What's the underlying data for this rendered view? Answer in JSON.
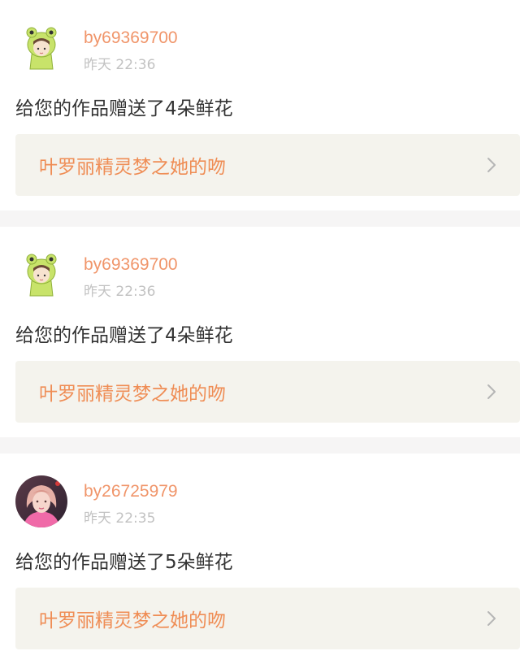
{
  "posts": [
    {
      "username": "by69369700",
      "time": "昨天 22:36",
      "message": "给您的作品赠送了4朵鲜花",
      "work_title": "叶罗丽精灵梦之她的吻",
      "avatar": "frog-hood-avatar-icon"
    },
    {
      "username": "by69369700",
      "time": "昨天 22:36",
      "message": "给您的作品赠送了4朵鲜花",
      "work_title": "叶罗丽精灵梦之她的吻",
      "avatar": "frog-hood-avatar-icon"
    },
    {
      "username": "by26725979",
      "time": "昨天 22:35",
      "message": "给您的作品赠送了5朵鲜花",
      "work_title": "叶罗丽精灵梦之她的吻",
      "avatar": "girl-photo-avatar-icon"
    }
  ],
  "colors": {
    "username": "#f0956a",
    "time": "#c2c2c2",
    "message": "#333333",
    "link_bg": "#f4f3ed",
    "link_text": "#ef8d55",
    "separator": "#f6f5f5"
  }
}
